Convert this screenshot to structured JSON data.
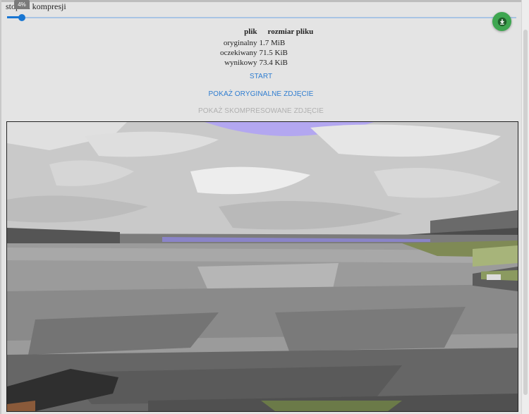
{
  "slider": {
    "label": "stopień kompresji",
    "value_text": "4%",
    "value": 0.04
  },
  "table": {
    "headers": [
      "plik",
      "rozmiar pliku"
    ],
    "rows": [
      [
        "oryginalny",
        "1.7 MiB"
      ],
      [
        "oczekiwany",
        "71.5 KiB"
      ],
      [
        "wynikowy",
        "73.4 KiB"
      ]
    ]
  },
  "buttons": {
    "start": "START",
    "show_original": "POKAŻ ORYGINALNE ZDJĘCIE",
    "show_compressed": "POKAŻ SKOMPRESOWANE ZDJĘCIE"
  },
  "icons": {
    "download": "download-icon"
  },
  "colors": {
    "accent": "#1976d2",
    "link": "#2f7dd0",
    "disabled": "#b0b0b0",
    "fab": "#3ea650"
  }
}
